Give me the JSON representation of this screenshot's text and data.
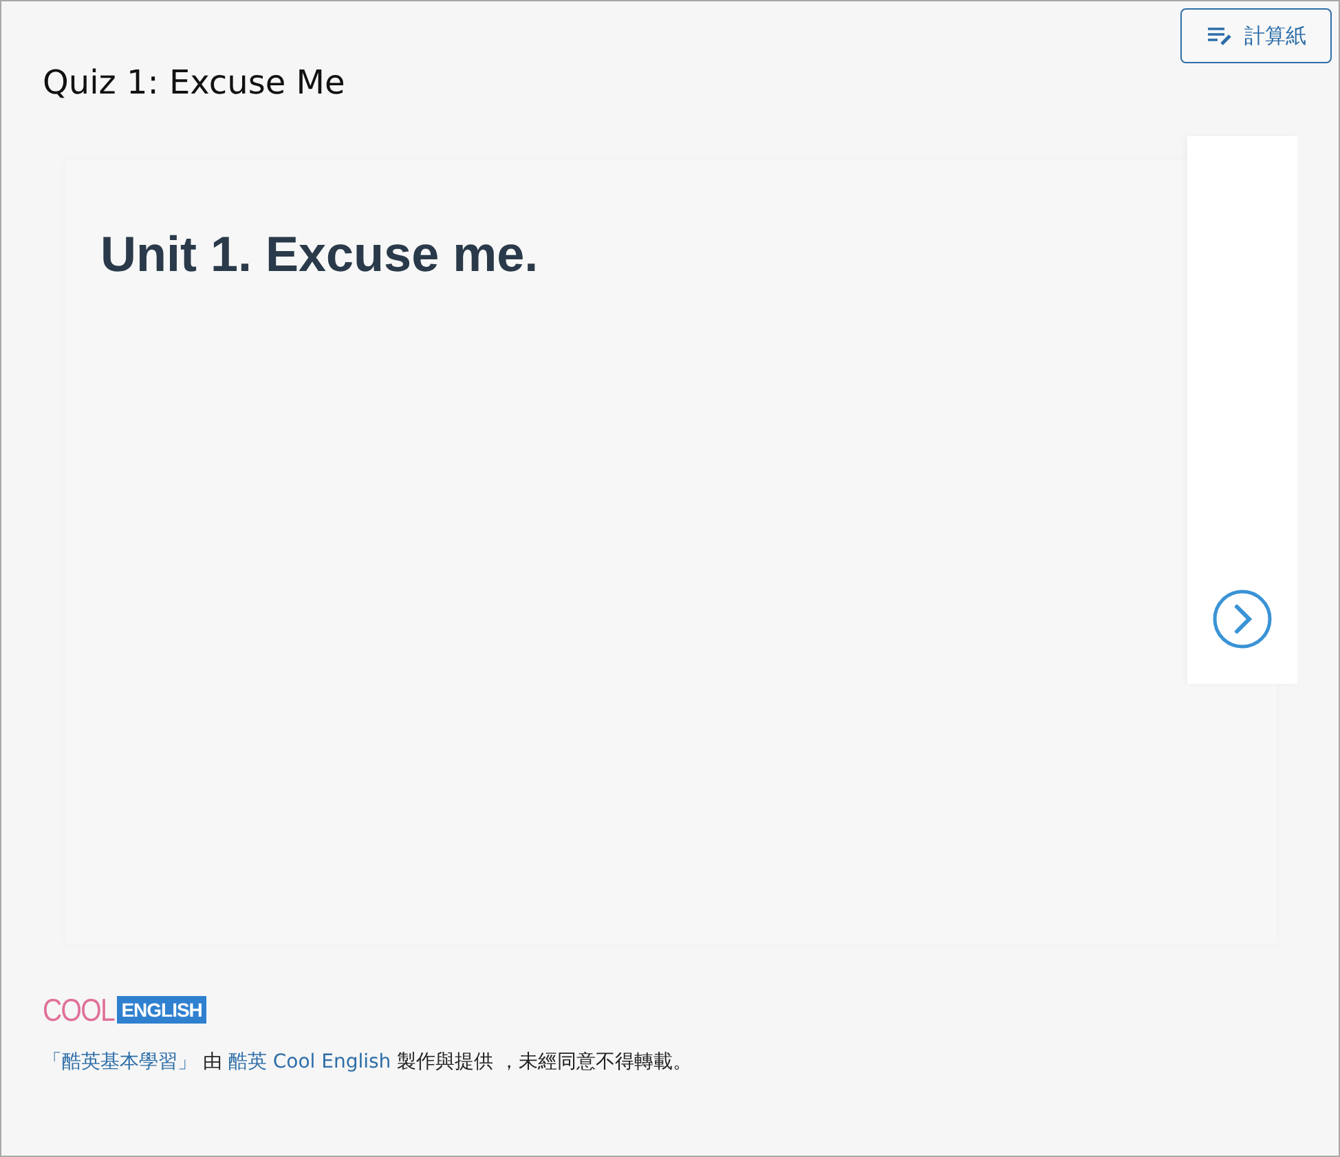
{
  "toolbar": {
    "scratch_button": "計算紙"
  },
  "quiz_title": "Quiz 1: Excuse Me",
  "slide": {
    "heading": "Unit 1. Excuse me."
  },
  "footer": {
    "logo": {
      "part_1": "COOL",
      "part_2": "ENGLISH"
    },
    "notice": {
      "open_quote": "「",
      "link_1": "酷英基本學習",
      "close_quote": "」",
      "text_1": "由",
      "link_2": "酷英 Cool English",
      "text_2": "製作與提供 ，未經同意不得轉載。"
    }
  }
}
